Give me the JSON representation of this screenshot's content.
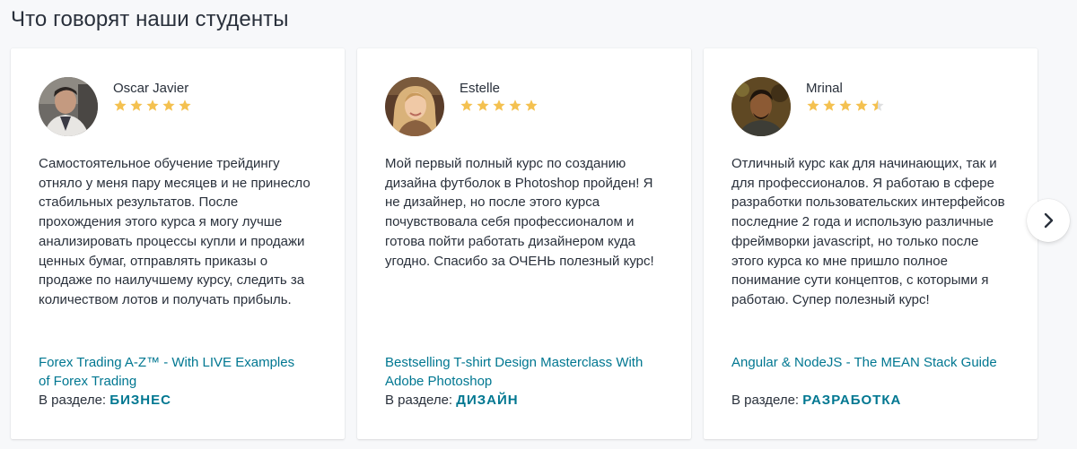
{
  "section": {
    "title": "Что говорят наши студенты"
  },
  "colors": {
    "link": "#007791",
    "text": "#29303b",
    "star_filled": "#f4c150",
    "star_empty": "#dedfe0",
    "background": "#f7f8fa"
  },
  "testimonials": [
    {
      "author": "Oscar Javier",
      "rating": 5,
      "text": "Самостоятельное обучение трейдингу отняло у меня пару месяцев и не принесло стабильных результатов. После прохождения этого курса я могу лучше анализировать процессы купли и продажи ценных бумаг, отправлять приказы о продаже по наилучшему курсу, следить за количеством лотов и получать прибыль.",
      "course": "Forex Trading A-Z™ - With LIVE Examples of Forex Trading",
      "category_prefix": "В разделе:",
      "category": "БИЗНЕС"
    },
    {
      "author": "Estelle",
      "rating": 5,
      "text": "Мой первый полный курс по созданию дизайна футболок в Photoshop пройден! Я не дизайнер, но после этого курса почувствовала себя профессионалом и готова пойти работать дизайнером куда угодно. Спасибо за ОЧЕНЬ полезный курс!",
      "course": "Bestselling T-shirt Design Masterclass With Adobe Photoshop",
      "category_prefix": "В разделе:",
      "category": "ДИЗАЙН"
    },
    {
      "author": "Mrinal",
      "rating": 4.5,
      "text": "Отличный курс как для начинающих, так и для профессионалов. Я работаю в сфере разработки пользовательских интерфейсов последние 2 года и использую различные фреймворки javascript, но только после этого курса ко мне пришло полное понимание сути концептов, с которыми я работаю. Супер полезный курс!",
      "course": "Angular & NodeJS - The MEAN Stack Guide",
      "category_prefix": "В разделе:",
      "category": "РАЗРАБОТКА"
    }
  ],
  "carousel": {
    "next_icon": "chevron-right-icon"
  }
}
